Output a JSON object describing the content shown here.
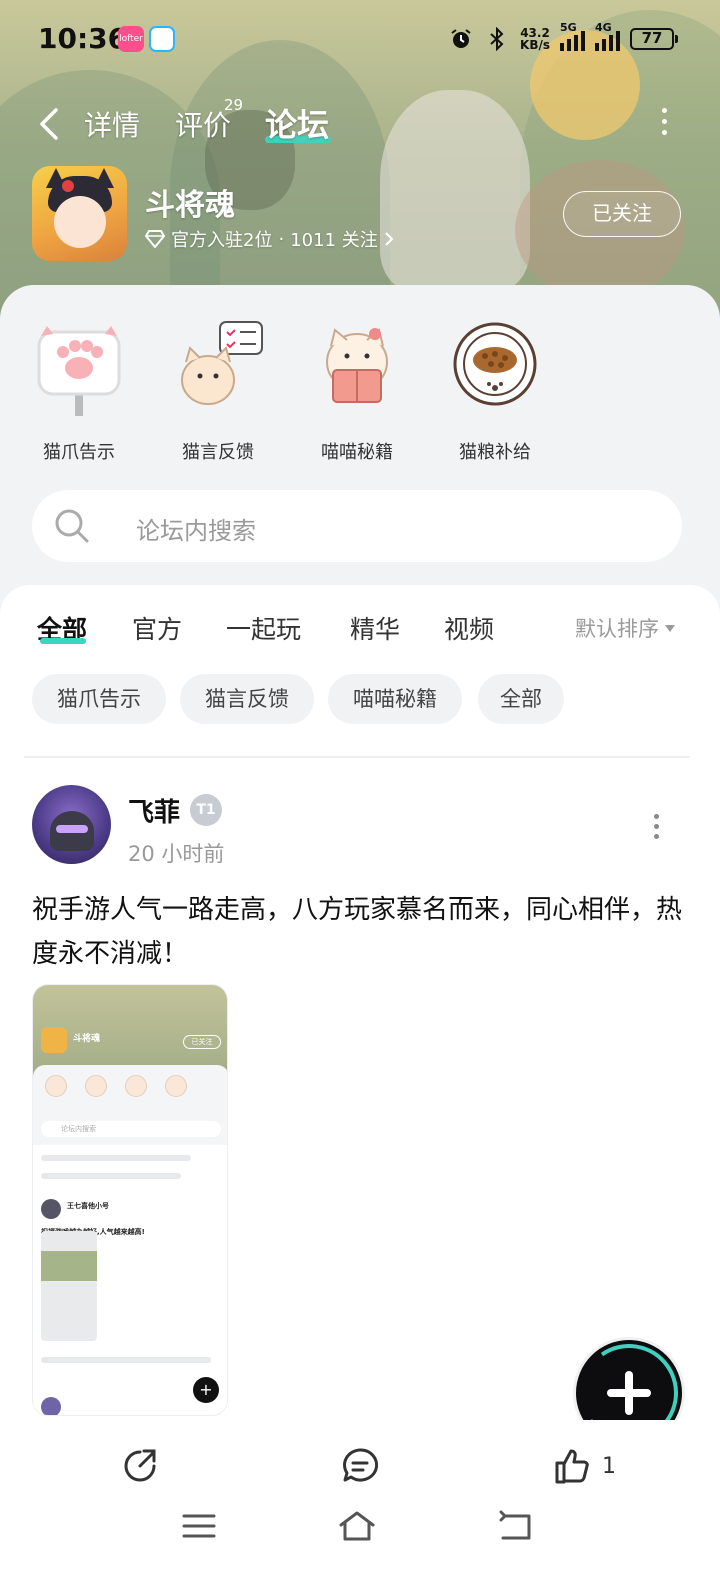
{
  "status_bar": {
    "time": "10:36",
    "net_speed_value": "43.2",
    "net_speed_unit": "KB/s",
    "signal1_label": "5G",
    "signal2_label": "4G",
    "battery": "77",
    "app_icon_a": "Lofter-icon",
    "app_icon_b": "app-icon"
  },
  "nav": {
    "tabs": [
      {
        "label": "详情"
      },
      {
        "label": "评价",
        "badge": "29"
      },
      {
        "label": "论坛"
      }
    ],
    "active_tab": "论坛",
    "accent_color": "#3ad6c2"
  },
  "game": {
    "title": "斗将魂",
    "meta_rank": "官方入驻2位",
    "meta_sep": "·",
    "meta_follows": "1011 关注",
    "follow_label": "已关注"
  },
  "quick_links": [
    {
      "label": "猫爪告示",
      "icon": "paw-sign-icon"
    },
    {
      "label": "猫言反馈",
      "icon": "cat-feedback-icon"
    },
    {
      "label": "喵喵秘籍",
      "icon": "cat-book-icon"
    },
    {
      "label": "猫粮补给",
      "icon": "cat-food-bowl-icon"
    }
  ],
  "search": {
    "placeholder": "论坛内搜索"
  },
  "feed_tabs": [
    {
      "label": "全部"
    },
    {
      "label": "官方"
    },
    {
      "label": "一起玩"
    },
    {
      "label": "精华"
    },
    {
      "label": "视频"
    }
  ],
  "sort_label": "默认排序",
  "chips": [
    {
      "label": "猫爪告示"
    },
    {
      "label": "猫言反馈"
    },
    {
      "label": "喵喵秘籍"
    },
    {
      "label": "全部"
    }
  ],
  "post": {
    "author": "飞菲",
    "level_badge": "T1",
    "time": "20 小时前",
    "text": "祝手游人气一路走高，八方玩家慕名而来，同心相伴，热度永不消减！",
    "likes": "1"
  },
  "thumbnail": {
    "title": "斗将魂",
    "follow": "已关注",
    "search": "论坛内搜索",
    "author": "王七喜他小号",
    "text": "祝福游戏越办越好,人气越来越高!"
  },
  "icons": {
    "share": "share-icon",
    "comment": "comment-icon",
    "like": "thumbs-up-icon",
    "fab": "plus-icon"
  }
}
